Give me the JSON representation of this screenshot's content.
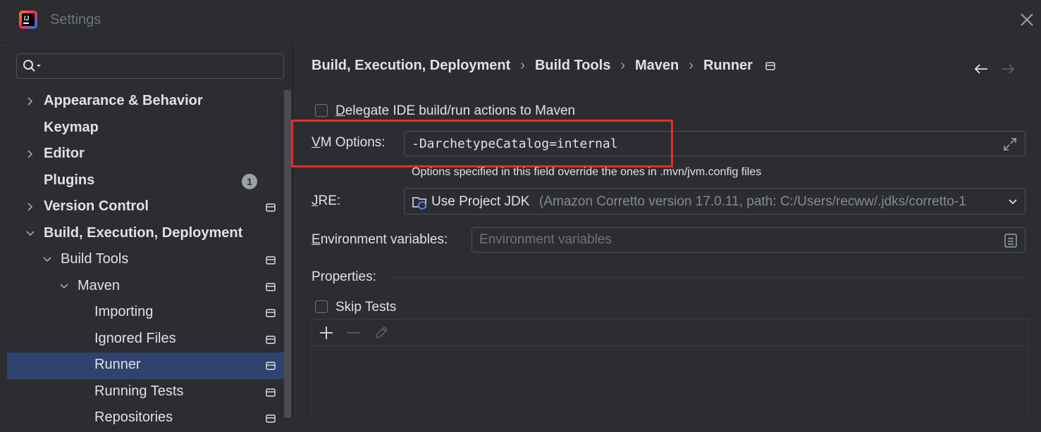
{
  "window": {
    "title": "Settings",
    "logo_icon": "intellij-idea-logo-icon",
    "close_icon": "close-icon"
  },
  "search": {
    "value": "",
    "icon": "search-icon"
  },
  "tree": {
    "items": [
      {
        "label": "Appearance & Behavior",
        "bold": true,
        "expandable": true,
        "expanded": false
      },
      {
        "label": "Keymap",
        "bold": true
      },
      {
        "label": "Editor",
        "bold": true,
        "expandable": true,
        "expanded": false
      },
      {
        "label": "Plugins",
        "bold": true,
        "badge": "1"
      },
      {
        "label": "Version Control",
        "bold": true,
        "expandable": true,
        "expanded": false
      },
      {
        "label": "Build, Execution, Deployment",
        "bold": true,
        "expandable": true,
        "expanded": true
      },
      {
        "label": "Build Tools",
        "expandable": true,
        "expanded": true
      },
      {
        "label": "Maven",
        "expandable": true,
        "expanded": true
      },
      {
        "label": "Importing"
      },
      {
        "label": "Ignored Files"
      },
      {
        "label": "Runner",
        "selected": true
      },
      {
        "label": "Running Tests"
      },
      {
        "label": "Repositories"
      }
    ]
  },
  "breadcrumb": [
    "Build, Execution, Deployment",
    "Build Tools",
    "Maven",
    "Runner"
  ],
  "runner": {
    "delegate_label": "Delegate IDE build/run actions to Maven",
    "delegate_checked": false,
    "vm_options_label": "VM Options:",
    "vm_options_value": "-DarchetypeCatalog=internal",
    "vm_options_hint": "Options specified in this field override the ones in .mvn/jvm.config files",
    "jre_label": "JRE:",
    "jre_value": "Use Project JDK",
    "jre_detail": "(Amazon Corretto version 17.0.11, path: C:/Users/recww/.jdks/corretto-1",
    "env_label": "Environment variables:",
    "env_placeholder": "Environment variables",
    "properties_label": "Properties:",
    "skip_tests_label": "Skip Tests",
    "skip_tests_checked": false
  },
  "colors": {
    "highlight": "#ee2a24",
    "selection": "#2e436e",
    "background": "#2b2d30"
  }
}
